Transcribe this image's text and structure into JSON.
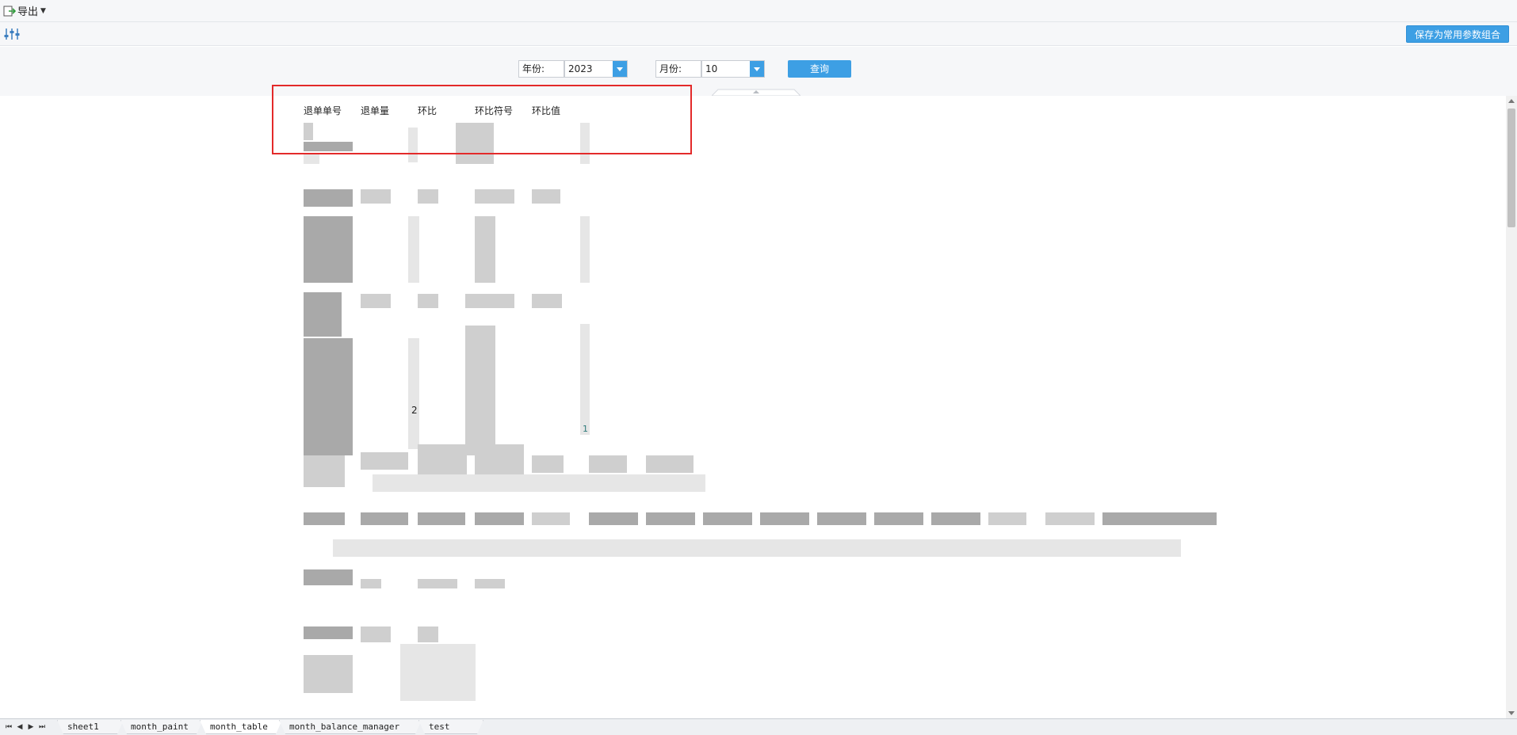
{
  "toolbar": {
    "export_label": "导出",
    "export_icon": "export-icon"
  },
  "parambar": {
    "save_combo_label": "保存为常用参数组合",
    "filter_icon": "filter-settings-icon"
  },
  "params": {
    "year_label": "年份:",
    "year_value": "2023",
    "month_label": "月份:",
    "month_value": "10",
    "query_label": "查询"
  },
  "report": {
    "headers": [
      "退单单号",
      "退单量",
      "环比",
      "环比符号",
      "环比值"
    ],
    "visible_value_1": "2",
    "visible_value_2": "1"
  },
  "sheets": {
    "tabs": [
      "sheet1",
      "month_paint",
      "month_table",
      "month_balance_manager",
      "test"
    ],
    "active": "month_table"
  },
  "colors": {
    "accent": "#3d9fe4",
    "highlight": "#e32a2a"
  }
}
